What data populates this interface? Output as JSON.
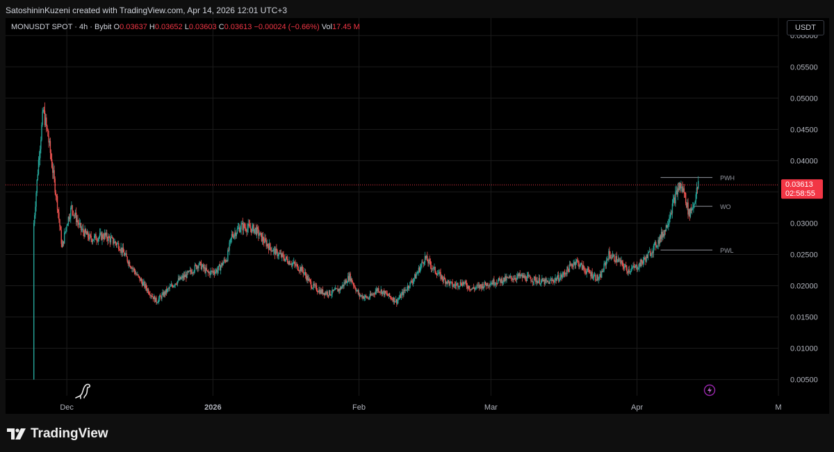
{
  "header": {
    "creator": "SatoshininKuzeni created with TradingView.com, Apr 14, 2026 12:01 UTC+3"
  },
  "legend": {
    "symbol": "MONUSDT SPOT · 4h · Bybit",
    "o_label": "O",
    "o": "0.03637",
    "h_label": "H",
    "h": "0.03652",
    "l_label": "L",
    "l": "0.03603",
    "c_label": "C",
    "c": "0.03613",
    "change": "−0.00024 (−0.66%)",
    "vol_label": "Vol",
    "vol": "17.45 M"
  },
  "currency": "USDT",
  "price_tag": {
    "price": "0.03613",
    "countdown": "02:58:55"
  },
  "colors": {
    "up": "#26a69a",
    "down": "#ef5350",
    "background": "#000000",
    "price_line": "#f23645",
    "level_line": "#9598a1",
    "grid": "#1c1c1c"
  },
  "icons": {
    "left_icon": "dinosaur-icon",
    "right_icon": "lightning-icon"
  },
  "footer": {
    "brand": "TradingView"
  },
  "chart_data": {
    "type": "candlestick",
    "symbol": "MONUSDT",
    "timeframe": "4h",
    "y_ticks": [
      "0.06000",
      "0.05500",
      "0.05000",
      "0.04500",
      "0.04000",
      "0.03500",
      "0.03000",
      "0.02500",
      "0.02000",
      "0.01500",
      "0.01000",
      "0.00500"
    ],
    "y_tick_values": [
      0.06,
      0.055,
      0.05,
      0.045,
      0.04,
      0.035,
      0.03,
      0.025,
      0.02,
      0.015,
      0.01,
      0.005
    ],
    "ylim": [
      0.0024,
      0.0628
    ],
    "x_axis": {
      "range": [
        "2025-11-18",
        "2026-05-01"
      ],
      "ticks": [
        {
          "label": "Dec",
          "date": "2025-12-01",
          "bold": false
        },
        {
          "label": "2026",
          "date": "2026-01-01",
          "bold": true
        },
        {
          "label": "Feb",
          "date": "2026-02-01",
          "bold": false
        },
        {
          "label": "Mar",
          "date": "2026-03-01",
          "bold": false
        },
        {
          "label": "Apr",
          "date": "2026-04-01",
          "bold": false
        },
        {
          "label": "M",
          "date": "2026-05-01",
          "bold": false
        }
      ]
    },
    "grid": true,
    "current_price": 0.03613,
    "levels": [
      {
        "name": "PWH",
        "value": 0.0373,
        "from": "2026-04-06",
        "to": "2026-04-17"
      },
      {
        "name": "WO",
        "value": 0.0327,
        "from": "2026-04-13",
        "to": "2026-04-17"
      },
      {
        "name": "PWL",
        "value": 0.0257,
        "from": "2026-04-06",
        "to": "2026-04-17"
      }
    ],
    "close_path": [
      [
        "2025-11-24",
        0.005
      ],
      [
        "2025-11-24",
        0.03
      ],
      [
        "2025-11-25",
        0.04
      ],
      [
        "2025-11-26",
        0.048
      ],
      [
        "2025-11-27",
        0.044
      ],
      [
        "2025-11-28",
        0.0385
      ],
      [
        "2025-11-29",
        0.033
      ],
      [
        "2025-11-30",
        0.026
      ],
      [
        "2025-12-01",
        0.03
      ],
      [
        "2025-12-02",
        0.0325
      ],
      [
        "2025-12-04",
        0.029
      ],
      [
        "2025-12-06",
        0.0275
      ],
      [
        "2025-12-09",
        0.028
      ],
      [
        "2025-12-12",
        0.0265
      ],
      [
        "2025-12-14",
        0.024
      ],
      [
        "2025-12-16",
        0.0215
      ],
      [
        "2025-12-18",
        0.0195
      ],
      [
        "2025-12-20",
        0.0175
      ],
      [
        "2025-12-22",
        0.019
      ],
      [
        "2025-12-24",
        0.0205
      ],
      [
        "2025-12-27",
        0.022
      ],
      [
        "2025-12-29",
        0.0235
      ],
      [
        "2025-12-31",
        0.022
      ],
      [
        "2026-01-02",
        0.0225
      ],
      [
        "2026-01-04",
        0.0245
      ],
      [
        "2026-01-05",
        0.028
      ],
      [
        "2026-01-07",
        0.0295
      ],
      [
        "2026-01-10",
        0.029
      ],
      [
        "2026-01-12",
        0.027
      ],
      [
        "2026-01-14",
        0.0255
      ],
      [
        "2026-01-16",
        0.0245
      ],
      [
        "2026-01-18",
        0.0235
      ],
      [
        "2026-01-20",
        0.0225
      ],
      [
        "2026-01-22",
        0.02
      ],
      [
        "2026-01-24",
        0.019
      ],
      [
        "2026-01-26",
        0.0188
      ],
      [
        "2026-01-28",
        0.0195
      ],
      [
        "2026-01-30",
        0.0215
      ],
      [
        "2026-02-01",
        0.0185
      ],
      [
        "2026-02-03",
        0.018
      ],
      [
        "2026-02-05",
        0.0195
      ],
      [
        "2026-02-07",
        0.0185
      ],
      [
        "2026-02-09",
        0.0175
      ],
      [
        "2026-02-11",
        0.0195
      ],
      [
        "2026-02-13",
        0.0215
      ],
      [
        "2026-02-15",
        0.0245
      ],
      [
        "2026-02-17",
        0.0225
      ],
      [
        "2026-02-19",
        0.021
      ],
      [
        "2026-02-21",
        0.02
      ],
      [
        "2026-02-23",
        0.0205
      ],
      [
        "2026-02-25",
        0.0195
      ],
      [
        "2026-02-27",
        0.02
      ],
      [
        "2026-03-01",
        0.0205
      ],
      [
        "2026-03-04",
        0.021
      ],
      [
        "2026-03-07",
        0.0215
      ],
      [
        "2026-03-10",
        0.021
      ],
      [
        "2026-03-13",
        0.0205
      ],
      [
        "2026-03-16",
        0.0215
      ],
      [
        "2026-03-19",
        0.024
      ],
      [
        "2026-03-21",
        0.0225
      ],
      [
        "2026-03-24",
        0.021
      ],
      [
        "2026-03-26",
        0.025
      ],
      [
        "2026-03-28",
        0.024
      ],
      [
        "2026-03-30",
        0.0225
      ],
      [
        "2026-04-01",
        0.023
      ],
      [
        "2026-04-03",
        0.0245
      ],
      [
        "2026-04-05",
        0.0265
      ],
      [
        "2026-04-07",
        0.029
      ],
      [
        "2026-04-09",
        0.034
      ],
      [
        "2026-04-10",
        0.036
      ],
      [
        "2026-04-11",
        0.035
      ],
      [
        "2026-04-12",
        0.0315
      ],
      [
        "2026-04-13",
        0.033
      ],
      [
        "2026-04-14",
        0.0361
      ]
    ]
  }
}
